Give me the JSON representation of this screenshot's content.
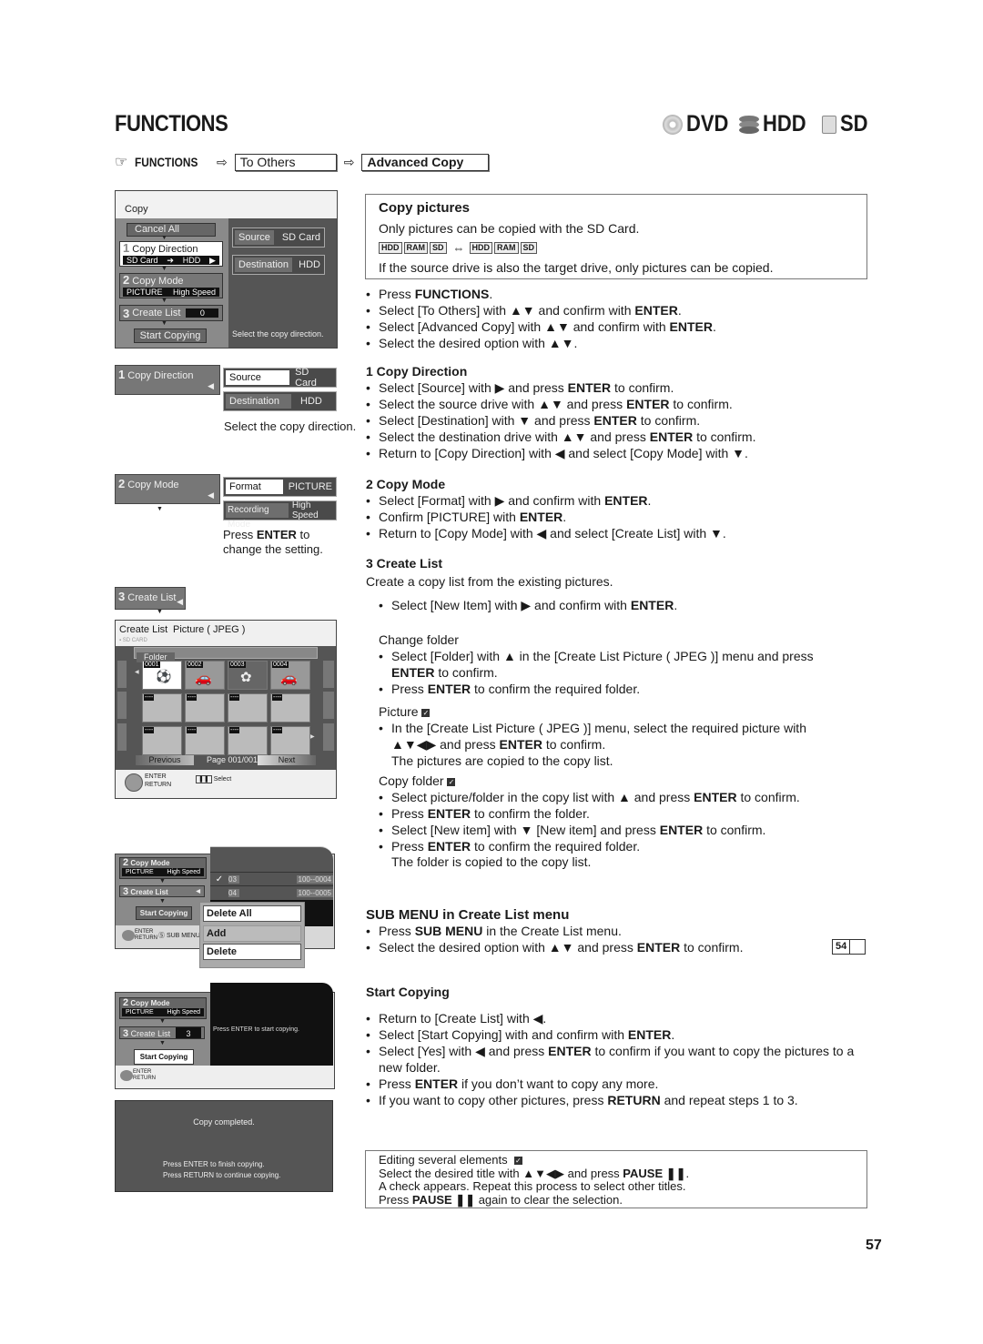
{
  "header": {
    "title": "FUNCTIONS",
    "media": [
      {
        "icon": "dvd-disc-icon",
        "label": "DVD"
      },
      {
        "icon": "hdd-icon",
        "label": "HDD"
      },
      {
        "icon": "sd-card-icon",
        "label": "SD"
      }
    ],
    "breadcrumb": {
      "root": "FUNCTIONS",
      "step1": "To Others",
      "step2": "Advanced Copy"
    }
  },
  "screen1": {
    "title": "Copy",
    "cancel_all": "Cancel All",
    "step1_num": "1",
    "step1_label": "Copy Direction",
    "step1_from": "SD Card",
    "step1_arrow": "➔",
    "step1_to": "HDD",
    "step2_num": "2",
    "step2_label": "Copy Mode",
    "step2_format": "PICTURE",
    "step2_speed": "High Speed",
    "step3_num": "3",
    "step3_label": "Create List",
    "step3_count": "0",
    "start_copying": "Start Copying",
    "source_key": "Source",
    "source_val": "SD Card",
    "dest_key": "Destination",
    "dest_val": "HDD",
    "hint": "Select the copy direction."
  },
  "screen2": {
    "step_num": "1",
    "step_label": "Copy Direction",
    "source_key": "Source",
    "source_val": "SD Card",
    "dest_key": "Destination",
    "dest_val": "HDD",
    "hint": "Select the copy direction."
  },
  "screen3": {
    "step_num": "2",
    "step_label": "Copy Mode",
    "format_key": "Format",
    "format_val": "PICTURE",
    "rec_key": "Recording Mode",
    "rec_val": "High Speed",
    "hint_pre": "Press ",
    "hint_bold": "ENTER",
    "hint_post": " to change the setting."
  },
  "screen4": {
    "step_num": "3",
    "step_label": "Create List",
    "title": "Create List",
    "subtitle": "Picture ( JPEG )",
    "source": "SD CARD",
    "folder_tab": "Folder",
    "thumbs": [
      "0001",
      "0002",
      "0003",
      "0004"
    ],
    "empty_label": "----",
    "previous": "Previous",
    "page": "Page 001/001",
    "next": "Next",
    "enter": "ENTER",
    "return": "RETURN",
    "select": "Select"
  },
  "screen5": {
    "step2_num": "2",
    "step2_label": "Copy Mode",
    "format": "PICTURE",
    "speed": "High Speed",
    "step3_num": "3",
    "step3_label": "Create List",
    "start_copying": "Start Copying",
    "rows": [
      {
        "checked": true,
        "num": "03",
        "id": "100--0004"
      },
      {
        "checked": false,
        "num": "04",
        "id": "100--0005"
      }
    ],
    "submenu": [
      "Delete All",
      "Add",
      "Delete"
    ],
    "enter": "ENTER",
    "return": "RETURN",
    "sub_menu_label": "SUB MENU"
  },
  "screen6": {
    "step2_num": "2",
    "step2_label": "Copy Mode",
    "format": "PICTURE",
    "speed": "High Speed",
    "step3_num": "3",
    "step3_label": "Create List",
    "step3_count": "3",
    "start_copying": "Start Copying",
    "hint": "Press ENTER to start copying.",
    "enter": "ENTER",
    "return": "RETURN"
  },
  "screen7": {
    "message": "Copy completed.",
    "line1": "Press ENTER to finish copying.",
    "line2": "Press RETURN to continue copying."
  },
  "copy_pictures": {
    "title": "Copy pictures",
    "line1": "Only pictures can be copied with the SD Card.",
    "drives_left": [
      "HDD",
      "RAM",
      "SD"
    ],
    "drives_right": [
      "HDD",
      "RAM",
      "SD"
    ],
    "line2": "If the source drive is also the target drive, only pictures can be copied."
  },
  "intro_steps": [
    [
      "Press ",
      "FUNCTIONS",
      "."
    ],
    [
      "Select [To Others] with ▲▼ and confirm with ",
      "ENTER",
      "."
    ],
    [
      "Select [Advanced Copy] with ▲▼ and confirm with ",
      "ENTER",
      "."
    ],
    [
      "Select the desired option with ▲▼.",
      "",
      ""
    ]
  ],
  "section1": {
    "title": "1 Copy Direction",
    "items": [
      [
        "Select [Source] with ▶ and press ",
        "ENTER",
        " to confirm."
      ],
      [
        "Select the source drive with ▲▼ and press ",
        "ENTER",
        " to confirm."
      ],
      [
        "Select [Destination] with ▼ and press ",
        "ENTER",
        " to confirm."
      ],
      [
        "Select the destination drive with ▲▼ and press ",
        "ENTER",
        " to confirm."
      ],
      [
        "Return to [Copy Direction] with ◀  and select [Copy Mode] with ▼.",
        "",
        ""
      ]
    ]
  },
  "section2": {
    "title": "2 Copy Mode",
    "items": [
      [
        "Select [Format] with ▶ and confirm with ",
        "ENTER",
        "."
      ],
      [
        "Confirm [PICTURE] with ",
        "ENTER",
        "."
      ],
      [
        "Return to [Copy Mode] with ◀  and select [Create List] with ▼.",
        "",
        ""
      ]
    ]
  },
  "section3": {
    "title": "3 Create List",
    "intro": "Create a copy list from the existing pictures.",
    "item": [
      "Select [New Item] with ▶ and confirm with ",
      "ENTER",
      "."
    ],
    "change_folder": {
      "title": "Change folder",
      "items": [
        [
          "Select  [Folder]  with ▲ in the [Create List Picture ( JPEG )] menu and press ",
          "ENTER",
          " to confirm."
        ],
        [
          "Press ",
          "ENTER",
          " to confirm the required folder."
        ]
      ]
    },
    "picture": {
      "title": "Picture",
      "item": [
        "In the [Create List Picture ( JPEG )] menu, select the required picture with ▲▼◀▶ and press ",
        "ENTER",
        " to confirm."
      ],
      "note": "The pictures are copied to the copy list."
    },
    "copy_folder": {
      "title": "Copy folder",
      "items": [
        [
          "Select picture/folder in the copy list with ▲ and press ",
          "ENTER",
          " to confirm."
        ],
        [
          "Press ",
          "ENTER",
          " to confirm the folder."
        ],
        [
          "Select [New item]  with ▼ [New item] and press ",
          "ENTER",
          " to confirm."
        ],
        [
          "Press ",
          "ENTER",
          " to confirm the required folder."
        ]
      ],
      "note": "The folder is copied to the copy list."
    }
  },
  "sub_menu": {
    "title": "SUB MENU in Create List menu",
    "items": [
      [
        "Press ",
        "SUB MENU",
        " in the Create List menu."
      ],
      [
        "Select the desired option with ▲▼ and press ",
        "ENTER",
        " to confirm."
      ]
    ],
    "page_ref": "54"
  },
  "start_copying": {
    "title": "Start Copying",
    "items": [
      [
        "Return to [Create List] with ◀.",
        "",
        ""
      ],
      [
        "Select [Start Copying] with and confirm with ",
        "ENTER",
        "."
      ],
      [
        "Select [Yes] with ◀  and press ",
        "ENTER",
        " to confirm if you want to copy the pictures to a new folder."
      ],
      [
        "Press ",
        "ENTER",
        " if you don’t want to copy any more."
      ],
      [
        "If you want to copy other pictures, press ",
        "RETURN",
        " and repeat steps 1 to 3."
      ]
    ]
  },
  "editing_note": {
    "title": "Editing several elements",
    "line1": [
      "Select the desired title with ▲▼◀▶ and press ",
      "PAUSE ❚❚",
      "."
    ],
    "line2": "A check appears. Repeat this process to select other titles.",
    "line3": [
      "Press ",
      "PAUSE ❚❚",
      " again to clear the selection."
    ]
  },
  "page_number": "57"
}
